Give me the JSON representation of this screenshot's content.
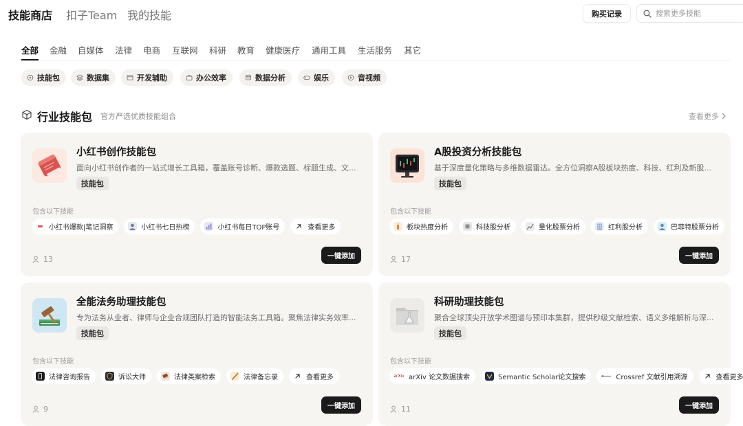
{
  "header": {
    "nav_tabs": [
      {
        "label": "技能商店"
      },
      {
        "label": "扣子Team"
      },
      {
        "label": "我的技能"
      }
    ],
    "purchase_button": "购买记录",
    "search_placeholder": "搜索更多技能"
  },
  "categories": [
    "全部",
    "金融",
    "自媒体",
    "法律",
    "电商",
    "互联网",
    "科研",
    "教育",
    "健康医疗",
    "通用工具",
    "生活服务",
    "其它"
  ],
  "active_category": "全部",
  "filter_chips": [
    {
      "label": "技能包",
      "icon": "package-icon"
    },
    {
      "label": "数据集",
      "icon": "layers-icon"
    },
    {
      "label": "开发辅助",
      "icon": "window-icon"
    },
    {
      "label": "办公效率",
      "icon": "briefcase-icon"
    },
    {
      "label": "数据分析",
      "icon": "database-icon"
    },
    {
      "label": "娱乐",
      "icon": "gamepad-icon"
    },
    {
      "label": "音视频",
      "icon": "music-icon"
    }
  ],
  "section": {
    "title": "行业技能包",
    "subtitle": "官方严选优质技能组合",
    "see_more": "查看更多"
  },
  "cards": [
    {
      "title": "小红书创作技能包",
      "description": "面向小红书创作者的一站式增长工具箱，覆盖账号诊断、爆款选题、标题生成、文...",
      "badge": "技能包",
      "includes_label": "包含以下技能",
      "skills": [
        {
          "label": "小红书爆款|笔记洞察",
          "icon": "xiaohongshu-icon"
        },
        {
          "label": "小红书七日热榜",
          "icon": "avatar-icon"
        },
        {
          "label": "小红书每日TOP账号",
          "icon": "chart-icon"
        },
        {
          "label": "查看更多",
          "icon": "arrow-up-right-icon"
        }
      ],
      "users": "13",
      "add_button": "一键添加"
    },
    {
      "title": "A股投资分析技能包",
      "description": "基于深度量化策略与多维数据雷达。全方位洞察A股板块热度、科技、红利及新股...",
      "badge": "技能包",
      "includes_label": "包含以下技能",
      "skills": [
        {
          "label": "板块热度分析",
          "icon": "candle-icon"
        },
        {
          "label": "科技股分析",
          "icon": "chip-icon"
        },
        {
          "label": "量化股票分析",
          "icon": "quant-icon"
        },
        {
          "label": "红利股分析",
          "icon": "building-icon"
        },
        {
          "label": "巴菲特股票分析",
          "icon": "portrait-icon"
        }
      ],
      "users": "17",
      "add_button": "一键添加"
    },
    {
      "title": "全能法务助理技能包",
      "description": "专为法务从业者、律师与企业合规团队打造的智能法务工具箱。聚焦法律实务效率...",
      "badge": "技能包",
      "includes_label": "包含以下技能",
      "skills": [
        {
          "label": "法律咨询报告",
          "icon": "phone-icon"
        },
        {
          "label": "诉讼大师",
          "icon": "shield-icon"
        },
        {
          "label": "法律类案检索",
          "icon": "book-icon"
        },
        {
          "label": "法律备忘录",
          "icon": "pen-icon"
        },
        {
          "label": "查看更多",
          "icon": "arrow-up-right-icon"
        }
      ],
      "users": "9",
      "add_button": "一键添加"
    },
    {
      "title": "科研助理技能包",
      "description": "聚合全球顶尖开放学术图谱与预印本集群，提供秒级文献检索、语义多维解析与深...",
      "badge": "技能包",
      "includes_label": "包含以下技能",
      "skills": [
        {
          "label": "arXiv 论文数据搜索",
          "icon": "arxiv-icon",
          "icon_text": "arXiv"
        },
        {
          "label": "Semantic Scholar论文搜索",
          "icon": "semantic-scholar-icon"
        },
        {
          "label": "Crossref 文献引用溯源",
          "icon": "crossref-icon"
        },
        {
          "label": "查看更多",
          "icon": "arrow-up-right-icon"
        }
      ],
      "users": "11",
      "add_button": "一键添加"
    }
  ]
}
